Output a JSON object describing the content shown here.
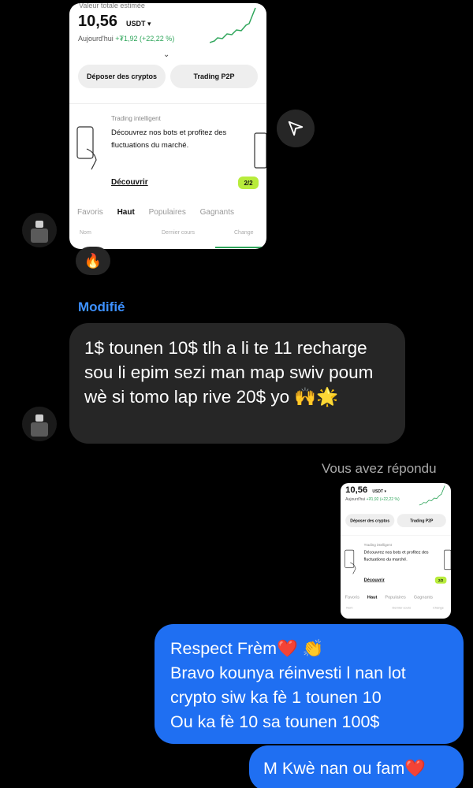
{
  "shared_screenshot": {
    "label": "Valeur totale estimée",
    "balance": "10,56",
    "unit": "USDT ▾",
    "today_label": "Aujourd'hui",
    "today_change": "+₮1,92 (+22,22 %)",
    "buttons": [
      "Déposer des cryptos",
      "Trading P2P"
    ],
    "promo": {
      "title": "Trading intelligent",
      "body": "Découvrez nos bots et profitez des fluctuations du marché.",
      "cta": "Découvrir",
      "pager": "2/2"
    },
    "tabs": [
      "Favoris",
      "Haut",
      "Populaires",
      "Gagnants"
    ],
    "active_tab": "Haut",
    "columns": [
      "Nom",
      "Dernier cours",
      "Change"
    ],
    "accent_color": "#2ea55a"
  },
  "reaction": "🔥",
  "edited_label": "Modifié",
  "incoming_message": "1$ tounen 10$ tlh a li te 11 recharge sou li epim sezi man map swiv poum wè si tomo lap rive 20$ yo 🙌🌟",
  "replied_label": "Vous avez répondu",
  "outgoing_message_1": {
    "line1": "Respect Frèm",
    "line1_emoji": "❤️ 👏",
    "line2": "Bravo  kounya réinvesti l nan lot",
    "line3": "crypto siw ka fè 1 tounen 10",
    "line4": "Ou ka fè 10 sa tounen 100$"
  },
  "outgoing_message_2": {
    "text": "M Kwè nan ou fam",
    "emoji": "❤️"
  },
  "colors": {
    "incoming_bubble": "#262626",
    "outgoing_bubble": "#1f6ff2",
    "edited_label": "#3d91ff"
  }
}
